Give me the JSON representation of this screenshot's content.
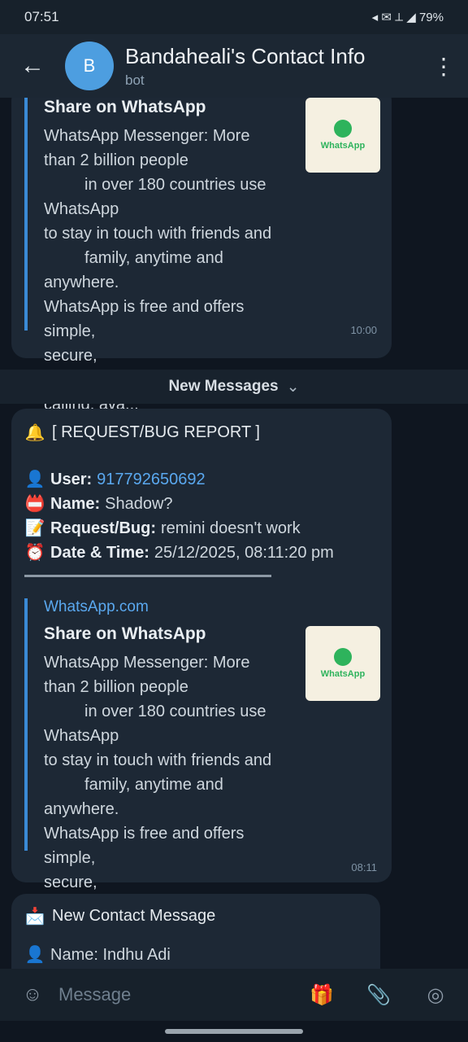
{
  "status_bar": {
    "time": "07:51",
    "icons": "◂ ✉ ⟂ ◢ 79%"
  },
  "header": {
    "back_icon": "←",
    "avatar_initial": "B",
    "title": "Bandaheali's Contact Info",
    "subtitle": "bot",
    "menu_icon": "⋮"
  },
  "messages": {
    "first": {
      "preview_title": "Share on WhatsApp",
      "preview_desc": "WhatsApp Messenger: More\nthan 2 billion people\n         in over 180 countries use WhatsApp\nto stay in touch with friends and\n         family, anytime and anywhere.\nWhatsApp is free and offers simple,\nsecure,\n         reliable messaging and calling, ava...",
      "thumb_label": "WhatsApp",
      "time": "10:00"
    },
    "new_messages_label": "New Messages",
    "second": {
      "heading": "[ REQUEST/BUG REPORT ]",
      "user_label": "User:",
      "user_value": "917792650692",
      "name_label": "Name:",
      "name_value": "Shadow?",
      "request_label": "Request/Bug:",
      "request_value": "remini doesn't work",
      "date_label": "Date & Time:",
      "date_value": "25/12/2025, 08:11:20 pm",
      "preview_site": "WhatsApp.com",
      "preview_title": "Share on WhatsApp",
      "preview_desc": "WhatsApp Messenger: More\nthan 2 billion people\n         in over 180 countries use WhatsApp\nto stay in touch with friends and\n         family, anytime and anywhere.\nWhatsApp is free and offers simple,\nsecure,\n         reliable messaging and calling, ava...",
      "thumb_label": "WhatsApp",
      "time": "08:11"
    },
    "third": {
      "heading": "New Contact Message",
      "partial_line": "Name: Indhu Adi"
    }
  },
  "input_bar": {
    "placeholder": "Message"
  },
  "colors": {
    "accent": "#4d9ee0",
    "link": "#5aa8ef",
    "bubble": "#1d2835",
    "background": "#0f1620"
  }
}
